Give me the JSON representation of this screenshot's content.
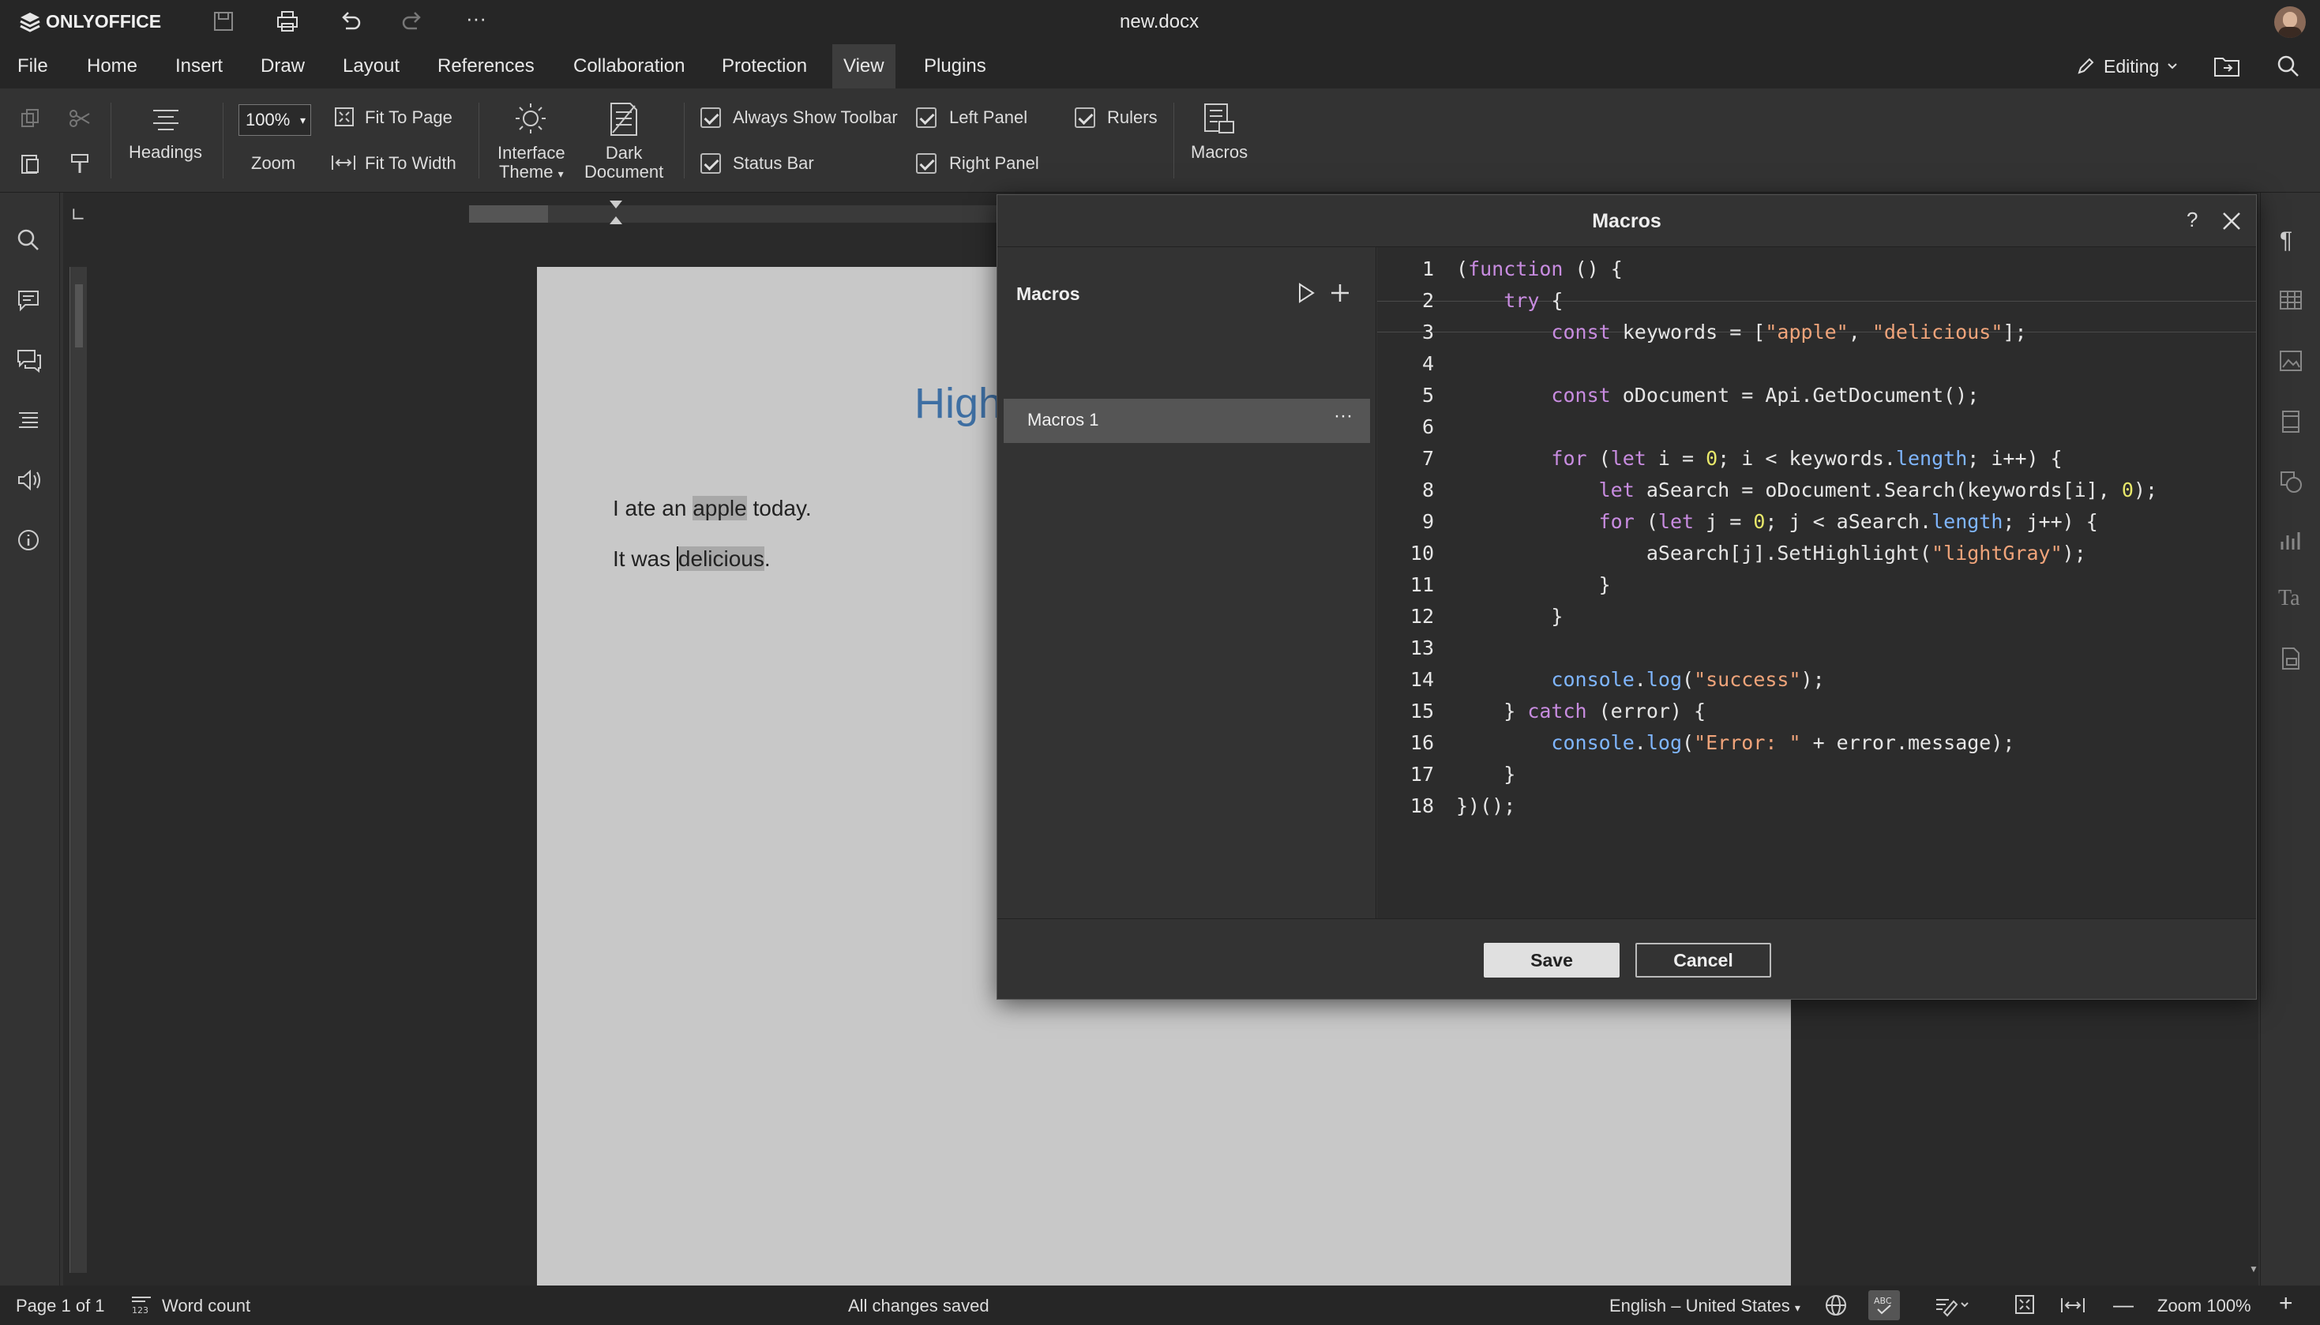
{
  "app": {
    "brand": "ONLYOFFICE",
    "doc_title": "new.docx"
  },
  "menu": {
    "items": [
      "File",
      "Home",
      "Insert",
      "Draw",
      "Layout",
      "References",
      "Collaboration",
      "Protection",
      "View",
      "Plugins"
    ],
    "active": "View",
    "mode_label": "Editing"
  },
  "ribbon": {
    "headings_label": "Headings",
    "zoom_value": "100%",
    "zoom_label": "Zoom",
    "fit_page": "Fit To Page",
    "fit_width": "Fit To Width",
    "interface_theme_1": "Interface",
    "interface_theme_2": "Theme",
    "dark_doc_1": "Dark",
    "dark_doc_2": "Document",
    "always_toolbar": "Always Show Toolbar",
    "status_bar": "Status Bar",
    "left_panel": "Left Panel",
    "right_panel": "Right Panel",
    "rulers": "Rulers",
    "macros": "Macros"
  },
  "document": {
    "heading_fragment": "High",
    "line1": {
      "pre": "I ate an ",
      "hl": "apple",
      "post": " today."
    },
    "line2": {
      "pre": "It was ",
      "hl": "delicious",
      "post": "."
    }
  },
  "dialog": {
    "title": "Macros",
    "help": "?",
    "list_title": "Macros",
    "macro_item": "Macros 1",
    "save_label": "Save",
    "cancel_label": "Cancel"
  },
  "code_lines": [
    "(function () {",
    "    try {",
    "        const keywords = [\"apple\", \"delicious\"];",
    "",
    "        const oDocument = Api.GetDocument();",
    "",
    "        for (let i = 0; i < keywords.length; i++) {",
    "            let aSearch = oDocument.Search(keywords[i], 0);",
    "            for (let j = 0; j < aSearch.length; j++) {",
    "                aSearch[j].SetHighlight(\"lightGray\");",
    "            }",
    "        }",
    "",
    "        console.log(\"success\");",
    "    } catch (error) {",
    "        console.log(\"Error: \" + error.message);",
    "    }",
    "})();"
  ],
  "status": {
    "page": "Page 1 of 1",
    "word_count": "Word count",
    "saved": "All changes saved",
    "language": "English – United States",
    "zoom": "Zoom 100%"
  },
  "colors": {
    "accent_blue": "#3e6fa3",
    "keyword": "#c88ce0",
    "string": "#f0a47a",
    "number": "#e8e86a",
    "builtin": "#7fb6ff"
  }
}
